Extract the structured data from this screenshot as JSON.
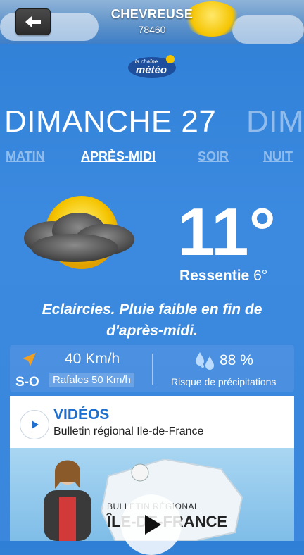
{
  "header": {
    "city": "CHEVREUSE",
    "postal_code": "78460",
    "back_icon": "arrow-left-icon"
  },
  "logo": {
    "line1": "la chaîne",
    "line2": "météo"
  },
  "days": {
    "current": "DIMANCHE 27",
    "next_partial": "DIMA"
  },
  "periods": [
    {
      "label": "MATIN",
      "active": false
    },
    {
      "label": "APRÈS-MIDI",
      "active": true
    },
    {
      "label": "SOIR",
      "active": false
    },
    {
      "label": "NUIT",
      "active": false
    }
  ],
  "forecast": {
    "icon": "sun-behind-cloud-rain-icon",
    "temperature": "11°",
    "feels_label": "Ressentie",
    "feels_value": "6°",
    "description": "Eclaircies. Pluie faible en fin de d'après-midi."
  },
  "wind": {
    "direction": "S-O",
    "speed": "40 Km/h",
    "gusts": "Rafales 50 Km/h"
  },
  "rain": {
    "percent": "88 %",
    "label": "Risque de précipitations"
  },
  "videos": {
    "title": "VIDÉOS",
    "subtitle": "Bulletin régional Ile-de-France",
    "thumb_small": "BULLETIN RÉGIONAL",
    "thumb_big": "ÎLE-DE-FRANCE"
  },
  "colors": {
    "accent": "#1f6fcf",
    "wind_arrow": "#f0a020",
    "sun": "#f5c400"
  }
}
